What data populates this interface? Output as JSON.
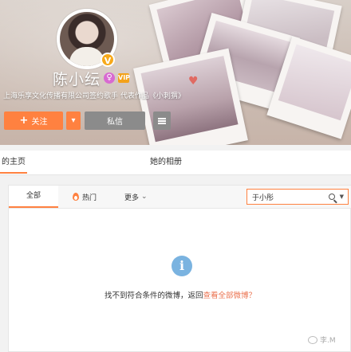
{
  "profile": {
    "name": "陈小纭",
    "verify_badge_letter": "V",
    "vip_label": "VIP",
    "gender_symbol": "♀",
    "verification": "上海乐享文化传播有限公司签约歌手 代表作品《小刺猬》",
    "follow_label": "关注",
    "message_label": "私信"
  },
  "tabs": {
    "home": "的主页",
    "album": "她的相册"
  },
  "filter": {
    "all": "全部",
    "hot": "热门",
    "more": "更多",
    "search_value": "于小彤"
  },
  "empty": {
    "message": "找不到符合条件的微博，返回",
    "link": "查看全部微博？"
  },
  "watermark": "李.M",
  "colors": {
    "accent": "#ff8140",
    "info_blue": "#7ab3e0",
    "button_gray": "#8b8b8b"
  }
}
